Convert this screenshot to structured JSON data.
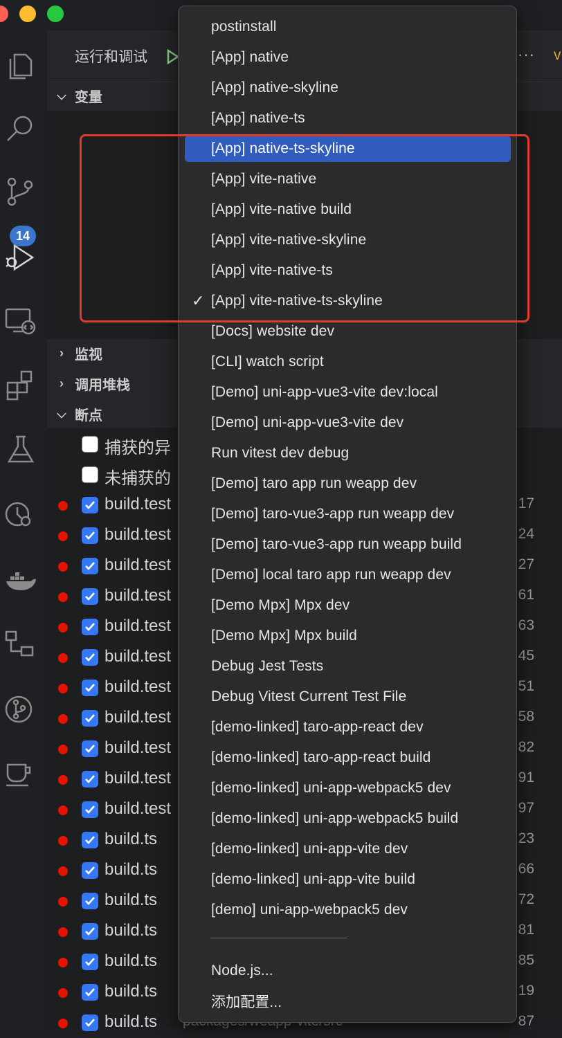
{
  "colors": {
    "accent": "#3b75cc",
    "selection": "#2f5cbd",
    "highlight": "#e23b2e",
    "breakpoint": "#e51400",
    "checkbox": "#3478f6"
  },
  "activity_bar": {
    "icons": [
      "files-icon",
      "search-icon",
      "source-control-icon",
      "run-debug-icon",
      "remote-explorer-icon",
      "extensions-icon",
      "testing-icon",
      "timeline-icon",
      "docker-icon",
      "diagram-icon",
      "git-graph-icon",
      "coffee-icon"
    ],
    "source_control_badge": "14"
  },
  "panel": {
    "title": "运行和调试",
    "more": "···",
    "right_glyph": "v",
    "sections": {
      "variables": "变量",
      "watch": "监视",
      "call_stack": "调用堆栈",
      "breakpoints": "断点"
    }
  },
  "breakpoints": [
    {
      "label": "捕获的异",
      "line": "",
      "checked": false,
      "dot": false
    },
    {
      "label": "未捕获的",
      "line": "",
      "checked": false,
      "dot": false
    },
    {
      "label": "build.test",
      "line": "17",
      "checked": true,
      "dot": true
    },
    {
      "label": "build.test",
      "line": "24",
      "checked": true,
      "dot": true
    },
    {
      "label": "build.test",
      "line": "27",
      "checked": true,
      "dot": true
    },
    {
      "label": "build.test",
      "line": "61",
      "checked": true,
      "dot": true
    },
    {
      "label": "build.test",
      "line": "63",
      "checked": true,
      "dot": true
    },
    {
      "label": "build.test",
      "line": "45",
      "checked": true,
      "dot": true
    },
    {
      "label": "build.test",
      "line": "51",
      "checked": true,
      "dot": true
    },
    {
      "label": "build.test",
      "line": "58",
      "checked": true,
      "dot": true
    },
    {
      "label": "build.test",
      "line": "82",
      "checked": true,
      "dot": true
    },
    {
      "label": "build.test",
      "line": "91",
      "checked": true,
      "dot": true
    },
    {
      "label": "build.test",
      "line": "97",
      "checked": true,
      "dot": true
    },
    {
      "label": "build.ts",
      "line": "23",
      "checked": true,
      "dot": true
    },
    {
      "label": "build.ts",
      "line": "66",
      "checked": true,
      "dot": true
    },
    {
      "label": "build.ts",
      "line": "72",
      "checked": true,
      "dot": true
    },
    {
      "label": "build.ts",
      "line": "81",
      "checked": true,
      "dot": true
    },
    {
      "label": "build.ts",
      "line": "85",
      "checked": true,
      "dot": true
    },
    {
      "label": "build.ts",
      "line": "19",
      "checked": true,
      "dot": true
    },
    {
      "label": "build.ts",
      "line": "87",
      "checked": true,
      "dot": true
    }
  ],
  "breakpoint_path_fragment": "packages/weapp-vite/src",
  "menu": {
    "items": [
      {
        "label": "postinstall"
      },
      {
        "label": "[App] native"
      },
      {
        "label": "[App] native-skyline"
      },
      {
        "label": "[App] native-ts"
      },
      {
        "label": "[App] native-ts-skyline",
        "selected": true
      },
      {
        "label": "[App] vite-native"
      },
      {
        "label": "[App] vite-native build"
      },
      {
        "label": "[App] vite-native-skyline"
      },
      {
        "label": "[App] vite-native-ts"
      },
      {
        "label": "[App] vite-native-ts-skyline",
        "checked": true
      },
      {
        "label": "[Docs] website dev"
      },
      {
        "label": "[CLI] watch script"
      },
      {
        "label": "[Demo] uni-app-vue3-vite dev:local"
      },
      {
        "label": "[Demo] uni-app-vue3-vite dev"
      },
      {
        "label": "Run vitest dev debug"
      },
      {
        "label": "[Demo] taro app run weapp dev"
      },
      {
        "label": "[Demo] taro-vue3-app run weapp dev"
      },
      {
        "label": "[Demo] taro-vue3-app run weapp build"
      },
      {
        "label": "[Demo] local taro app run weapp dev"
      },
      {
        "label": "[Demo Mpx] Mpx dev"
      },
      {
        "label": "[Demo Mpx] Mpx build"
      },
      {
        "label": "Debug Jest Tests"
      },
      {
        "label": "Debug Vitest Current Test File"
      },
      {
        "label": "[demo-linked] taro-app-react dev"
      },
      {
        "label": "[demo-linked] taro-app-react build"
      },
      {
        "label": "[demo-linked] uni-app-webpack5 dev"
      },
      {
        "label": "[demo-linked] uni-app-webpack5 build"
      },
      {
        "label": "[demo-linked] uni-app-vite dev"
      },
      {
        "label": "[demo-linked] uni-app-vite build"
      },
      {
        "label": "[demo] uni-app-webpack5 dev"
      }
    ],
    "check_glyph": "✓",
    "footer_items": [
      {
        "label": "Node.js..."
      },
      {
        "label": "添加配置..."
      }
    ]
  }
}
